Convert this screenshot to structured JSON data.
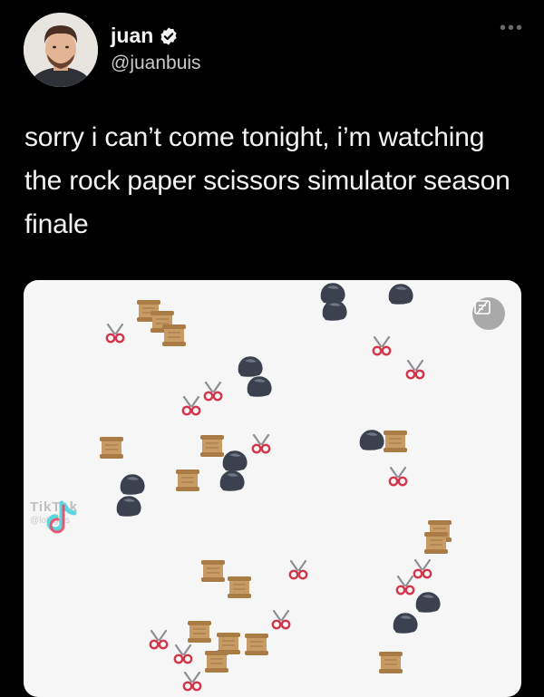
{
  "tweet": {
    "author_name": "juan",
    "author_handle": "@juanbuis",
    "more_icon": "more-horizontal-icon",
    "verified_icon": "verified-badge-icon",
    "text": "sorry i can’t come tonight, i’m watching the rock paper scissors simulator season finale"
  },
  "media": {
    "watermark_name": "TikTok",
    "watermark_user": "@lolegirls",
    "badge_icon": "gif-badge-icon",
    "icons": {
      "rock": "rock-icon",
      "paper": "paper-icon",
      "scissors": "scissors-icon"
    }
  }
}
